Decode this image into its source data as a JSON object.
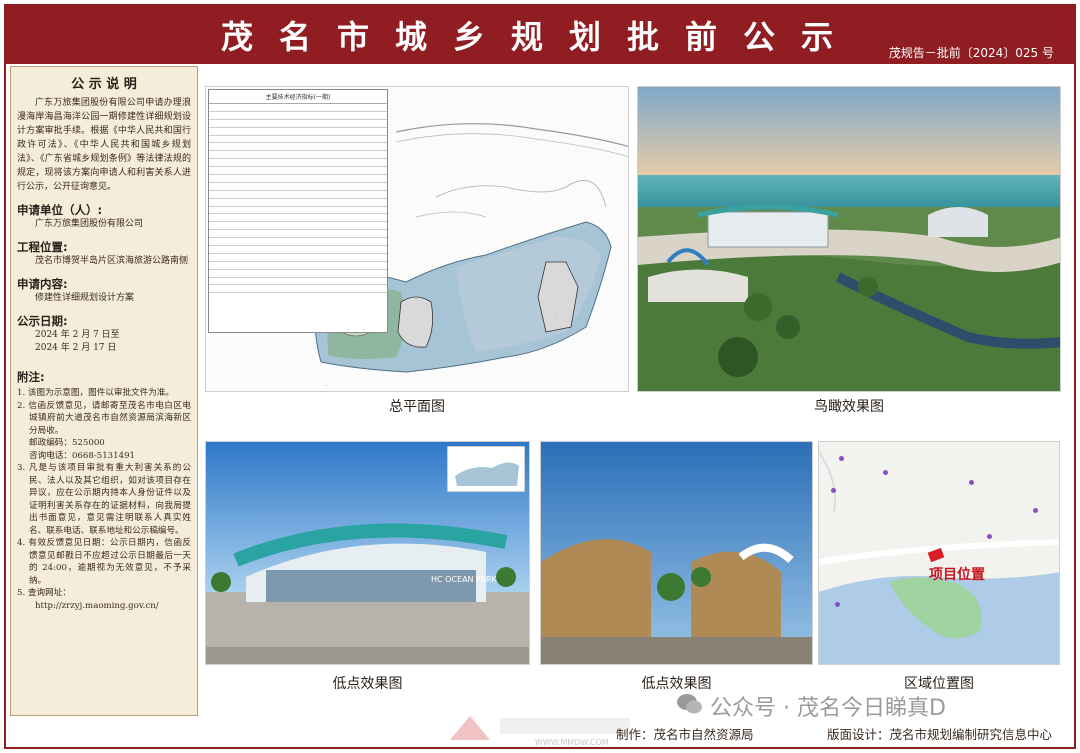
{
  "header": {
    "title": "茂名市城乡规划批前公示",
    "doc_number": "茂规告－批前〔2024〕025 号"
  },
  "sidebar": {
    "title": "公 示 说 明",
    "intro": "广东万旅集团股份有限公司申请办理浪漫海岸海昌海洋公园一期修建性详细规划设计方案审批手续。根据《中华人民共和国行政许可法》、《中华人民共和国城乡规划法》、《广东省城乡规划条例》等法律法规的规定，现将该方案向申请人和利害关系人进行公示，公开征询意见。",
    "applicant_label": "申请单位（人）:",
    "applicant": "广东万旅集团股份有限公司",
    "location_label": "工程位置:",
    "location": "茂名市博贺半岛片区滨海旅游公路南侧",
    "content_label": "申请内容:",
    "content": "修建性详细规划设计方案",
    "date_label": "公示日期:",
    "date_from": "2024 年 2 月 7 日至",
    "date_to": "2024 年 2 月 17 日",
    "notes_label": "附注:",
    "notes": [
      "1. 该图为示意图，图件以审批文件为准。",
      "2. 信函反馈意见，请邮寄至茂名市电白区电城镇府前大道茂名市自然资源局滨海新区分局收。",
      "邮政编码：525000",
      "咨询电话：0668-5131491",
      "3. 凡是与该项目审批有重大利害关系的公民、法人以及其它组织，如对该项目存在异议，应在公示期内持本人身份证件以及证明利害关系存在的证据材料，向我局提出书面意见，意见需注明联系人真实姓名、联系电话、联系地址和公示稿编号。",
      "4. 有效反馈意见日期：公示日期内，信函反馈意见邮戳日不应超过公示日期最后一天的 24:00，逾期视为无效意见，不予采纳。",
      "5. 查询网址：",
      "http://zrzyj.maoming.gov.cn/"
    ]
  },
  "panels": {
    "plan_caption": "总平面图",
    "aerial_caption": "鸟瞰效果图",
    "low1_caption": "低点效果图",
    "low2_caption": "低点效果图",
    "map_caption": "区域位置图",
    "plan_table_title": "主要技术经济指标(一期)",
    "map_pin_label": "项目位置",
    "building_sign": "HC OCEAN PARK"
  },
  "watermark": {
    "wechat": "公众号 · 茂名今日睇真D",
    "site": "WWW.MMDW.COM"
  },
  "footer": {
    "issuer": "制作：茂名市自然资源局",
    "designer": "版面设计：茂名市规划编制研究信息中心"
  }
}
